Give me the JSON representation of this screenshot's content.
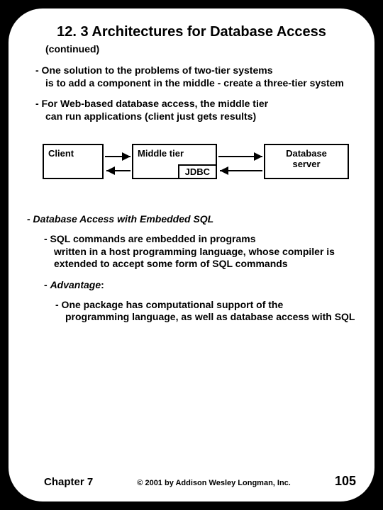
{
  "title": "12. 3 Architectures for Database Access",
  "subtitle": "(continued)",
  "para1_first": "- One solution to the problems of two-tier systems",
  "para1_rest": "is to add a component in the middle - create a three-tier system",
  "para2_first": "- For Web-based database access, the middle tier",
  "para2_rest": "can run applications (client just gets results)",
  "diagram": {
    "client": "Client",
    "middle": "Middle tier",
    "jdbc": "JDBC",
    "db1": "Database",
    "db2": "server"
  },
  "section_head": "- Database Access with Embedded SQL",
  "sub1_first": "- SQL commands are embedded in programs",
  "sub1_rest": "written in a host programming language, whose compiler is extended to accept some form of SQL commands",
  "adv_dash": "- ",
  "adv_word": "Advantage",
  "adv_colon": ":",
  "sub2_first": "- One package has computational support of the",
  "sub2_rest": "programming language, as well as database access with SQL",
  "footer": {
    "chapter": "Chapter 7",
    "copy": "© 2001 by Addison Wesley Longman, Inc.",
    "page": "105"
  }
}
